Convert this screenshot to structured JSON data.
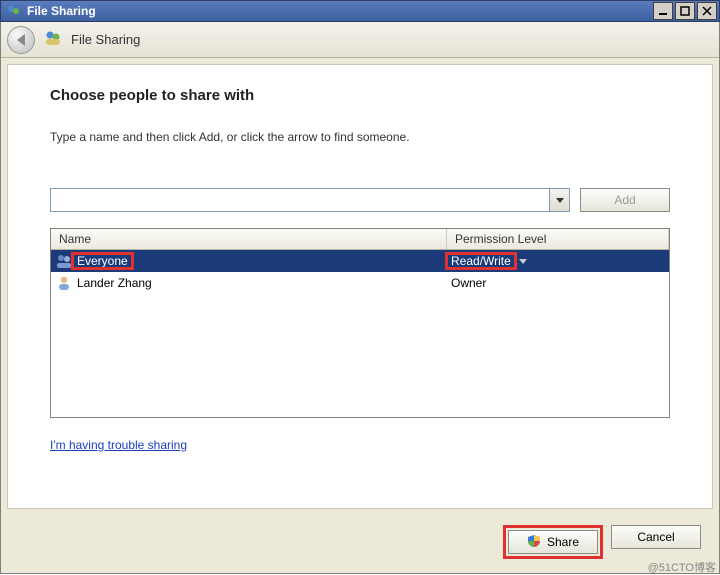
{
  "window": {
    "title": "File Sharing",
    "header_title": "File Sharing"
  },
  "content": {
    "heading": "Choose people to share with",
    "instruction": "Type a name and then click Add, or click the arrow to find someone.",
    "combo_value": "",
    "add_label": "Add",
    "columns": {
      "name": "Name",
      "perm": "Permission Level"
    },
    "rows": [
      {
        "name": "Everyone",
        "permission": "Read/Write",
        "type": "group",
        "selected": true,
        "has_dropdown": true
      },
      {
        "name": "Lander Zhang",
        "permission": "Owner",
        "type": "user",
        "selected": false,
        "has_dropdown": false
      }
    ],
    "trouble_link": "I'm having trouble sharing"
  },
  "footer": {
    "share_label": "Share",
    "cancel_label": "Cancel"
  },
  "watermark": "@51CTO博客"
}
